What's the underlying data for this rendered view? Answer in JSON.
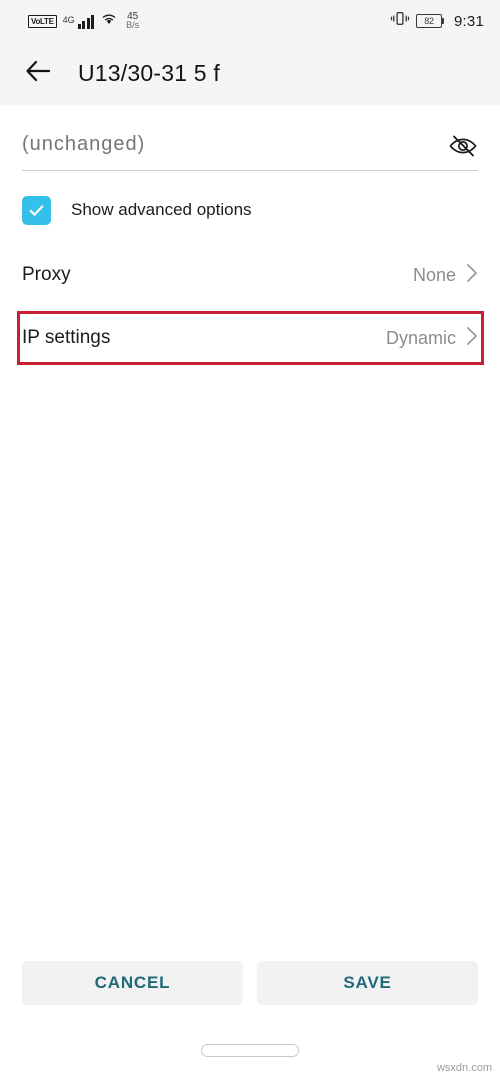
{
  "status_bar": {
    "volte_badge": "VoLTE",
    "network_gen": "4G",
    "signal_icon": "signal-bars-icon",
    "wifi_icon": "wifi-icon",
    "net_speed_value": "45",
    "net_speed_unit": "B/s",
    "vibrate_icon": "vibrate-icon",
    "battery_level": "82",
    "time": "9:31"
  },
  "app_bar": {
    "back_icon": "back-arrow-icon",
    "title": "U13/30-31 5 f"
  },
  "password_field": {
    "value": "",
    "placeholder": "(unchanged)",
    "visibility_icon": "eye-off-icon"
  },
  "advanced_checkbox": {
    "label": "Show advanced options",
    "checked": true,
    "color": "#35c0ea"
  },
  "settings_rows": [
    {
      "label": "Proxy",
      "value": "None",
      "chevron": "chevron-right-icon"
    },
    {
      "label": "IP settings",
      "value": "Dynamic",
      "chevron": "chevron-right-icon"
    }
  ],
  "highlight": {
    "target": "IP settings",
    "color": "#c62032"
  },
  "buttons": {
    "cancel": "CANCEL",
    "save": "SAVE",
    "text_color": "#1f6a78"
  },
  "nav_pill": "home-gesture-pill",
  "watermark": "wsxdn.com"
}
